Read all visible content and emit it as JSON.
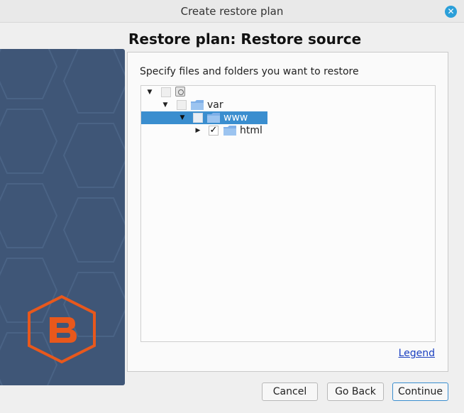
{
  "window": {
    "title": "Create restore plan",
    "close_icon": "close-icon"
  },
  "page": {
    "heading": "Restore plan: Restore source"
  },
  "source": {
    "prompt": "Specify files and folders you want to restore",
    "tree": [
      {
        "label": "",
        "icon": "drive-icon",
        "expanded": true,
        "checked": false,
        "selected": false
      },
      {
        "label": "var",
        "icon": "folder-icon",
        "expanded": true,
        "checked": false,
        "selected": false
      },
      {
        "label": "www",
        "icon": "folder-icon",
        "expanded": true,
        "checked": false,
        "selected": true
      },
      {
        "label": "html",
        "icon": "folder-icon",
        "expanded": false,
        "checked": true,
        "selected": false
      }
    ],
    "legend_link": "Legend"
  },
  "buttons": {
    "cancel": "Cancel",
    "back": "Go Back",
    "continue": "Continue"
  },
  "colors": {
    "brand_orange": "#e8581c",
    "side_panel": "#3f5677",
    "selection": "#3a8ecf",
    "folder": "#7fb0e8"
  }
}
